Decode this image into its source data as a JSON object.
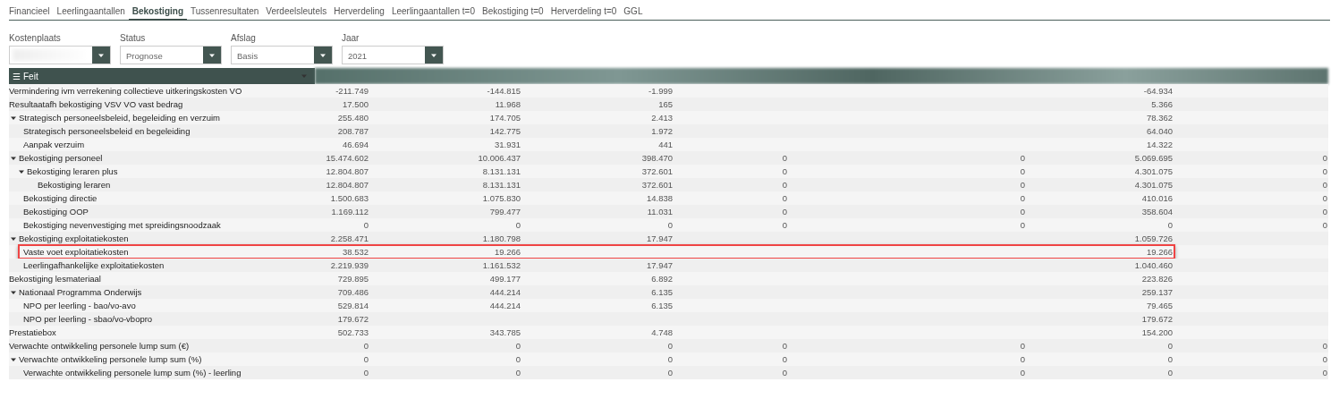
{
  "tabs": [
    {
      "label": "Financieel",
      "selected": false
    },
    {
      "label": "Leerlingaantallen",
      "selected": false
    },
    {
      "label": "Bekostiging",
      "selected": true
    },
    {
      "label": "Tussenresultaten",
      "selected": false
    },
    {
      "label": "Verdeelsleutels",
      "selected": false
    },
    {
      "label": "Herverdeling",
      "selected": false
    },
    {
      "label": "Leerlingaantallen t=0",
      "selected": false
    },
    {
      "label": "Bekostiging t=0",
      "selected": false
    },
    {
      "label": "Herverdeling t=0",
      "selected": false
    },
    {
      "label": "GGL",
      "selected": false
    }
  ],
  "filters": [
    {
      "label": "Kostenplaats",
      "value_blurred": true
    },
    {
      "label": "Status",
      "value": "Prognose"
    },
    {
      "label": "Afslag",
      "value": "Basis"
    },
    {
      "label": "Jaar",
      "value": "2021"
    }
  ],
  "table": {
    "header": {
      "menu_icon": "☰",
      "label": "Feit"
    },
    "rows": [
      {
        "label": "Vermindering ivm verrekening collectieve uitkeringskosten VO",
        "values": {
          "column_1": "-211.749",
          "column_2": "-144.815",
          "column_3": "-1.999",
          "column_6": "-64.934"
        }
      },
      {
        "label": "Resultaatafh bekostiging VSV VO vast bedrag",
        "values": {
          "column_1": "17.500",
          "column_2": "11.968",
          "column_3": "165",
          "column_6": "5.366"
        }
      },
      {
        "label": "Strategisch personeelsbeleid, begeleiding en verzuim",
        "expanded": true,
        "values": {
          "column_1": "255.480",
          "column_2": "174.705",
          "column_3": "2.413",
          "column_6": "78.362"
        },
        "children": [
          {
            "label": "Strategisch personeelsbeleid en begeleiding",
            "values": {
              "column_1": "208.787",
              "column_2": "142.775",
              "column_3": "1.972",
              "column_6": "64.040"
            }
          },
          {
            "label": "Aanpak verzuim",
            "values": {
              "column_1": "46.694",
              "column_2": "31.931",
              "column_3": "441",
              "column_6": "14.322"
            }
          }
        ]
      },
      {
        "label": "Bekostiging personeel",
        "expanded": true,
        "values": {
          "column_1": "15.474.602",
          "column_2": "10.006.437",
          "column_3": "398.470",
          "column_4": "0",
          "column_5": "0",
          "column_6": "5.069.695",
          "column_7": "0"
        },
        "children": [
          {
            "label": "Bekostiging leraren plus",
            "expanded": true,
            "values": {
              "column_1": "12.804.807",
              "column_2": "8.131.131",
              "column_3": "372.601",
              "column_4": "0",
              "column_5": "0",
              "column_6": "4.301.075",
              "column_7": "0"
            },
            "children": [
              {
                "label": "Bekostiging leraren",
                "values": {
                  "column_1": "12.804.807",
                  "column_2": "8.131.131",
                  "column_3": "372.601",
                  "column_4": "0",
                  "column_5": "0",
                  "column_6": "4.301.075",
                  "column_7": "0"
                }
              }
            ]
          },
          {
            "label": "Bekostiging directie",
            "values": {
              "column_1": "1.500.683",
              "column_2": "1.075.830",
              "column_3": "14.838",
              "column_4": "0",
              "column_5": "0",
              "column_6": "410.016",
              "column_7": "0"
            }
          },
          {
            "label": "Bekostiging OOP",
            "values": {
              "column_1": "1.169.112",
              "column_2": "799.477",
              "column_3": "11.031",
              "column_4": "0",
              "column_5": "0",
              "column_6": "358.604",
              "column_7": "0"
            }
          },
          {
            "label": "Bekostiging nevenvestiging met spreidingsnoodzaak",
            "values": {
              "column_1": "0",
              "column_2": "0",
              "column_3": "0",
              "column_4": "0",
              "column_5": "0",
              "column_6": "0",
              "column_7": "0"
            }
          }
        ]
      },
      {
        "label": "Bekostiging exploitatiekosten",
        "expanded": true,
        "values": {
          "column_1": "2.258.471",
          "column_2": "1.180.798",
          "column_3": "17.947",
          "column_6": "1.059.726"
        },
        "children": [
          {
            "label": "Vaste voet exploitatiekosten",
            "highlighted": true,
            "values": {
              "column_1": "38.532",
              "column_2": "19.266",
              "column_6": "19.266"
            }
          },
          {
            "label": "Leerlingafhankelijke exploitatiekosten",
            "values": {
              "column_1": "2.219.939",
              "column_2": "1.161.532",
              "column_3": "17.947",
              "column_6": "1.040.460"
            }
          }
        ]
      },
      {
        "label": "Bekostiging lesmateriaal",
        "values": {
          "column_1": "729.895",
          "column_2": "499.177",
          "column_3": "6.892",
          "column_6": "223.826"
        }
      },
      {
        "label": "Nationaal Programma Onderwijs",
        "expanded": true,
        "values": {
          "column_1": "709.486",
          "column_2": "444.214",
          "column_3": "6.135",
          "column_6": "259.137"
        },
        "children": [
          {
            "label": "NPO per leerling - bao/vo-avo",
            "values": {
              "column_1": "529.814",
              "column_2": "444.214",
              "column_3": "6.135",
              "column_6": "79.465"
            }
          },
          {
            "label": "NPO per leerling - sbao/vo-vbopro",
            "values": {
              "column_1": "179.672",
              "column_6": "179.672"
            }
          }
        ]
      },
      {
        "label": "Prestatiebox",
        "values": {
          "column_1": "502.733",
          "column_2": "343.785",
          "column_3": "4.748",
          "column_6": "154.200"
        }
      },
      {
        "label": "Verwachte ontwikkeling personele lump sum (€)",
        "values": {
          "column_1": "0",
          "column_2": "0",
          "column_3": "0",
          "column_4": "0",
          "column_5": "0",
          "column_6": "0",
          "column_7": "0"
        }
      },
      {
        "label": "Verwachte ontwikkeling personele lump sum (%)",
        "expanded": true,
        "values": {
          "column_1": "0",
          "column_2": "0",
          "column_3": "0",
          "column_4": "0",
          "column_5": "0",
          "column_6": "0",
          "column_7": "0"
        },
        "children": [
          {
            "label": "Verwachte ontwikkeling personele lump sum (%) - leerling",
            "values": {
              "column_1": "0",
              "column_2": "0",
              "column_3": "0",
              "column_4": "0",
              "column_5": "0",
              "column_6": "0",
              "column_7": "0"
            }
          }
        ]
      }
    ]
  }
}
